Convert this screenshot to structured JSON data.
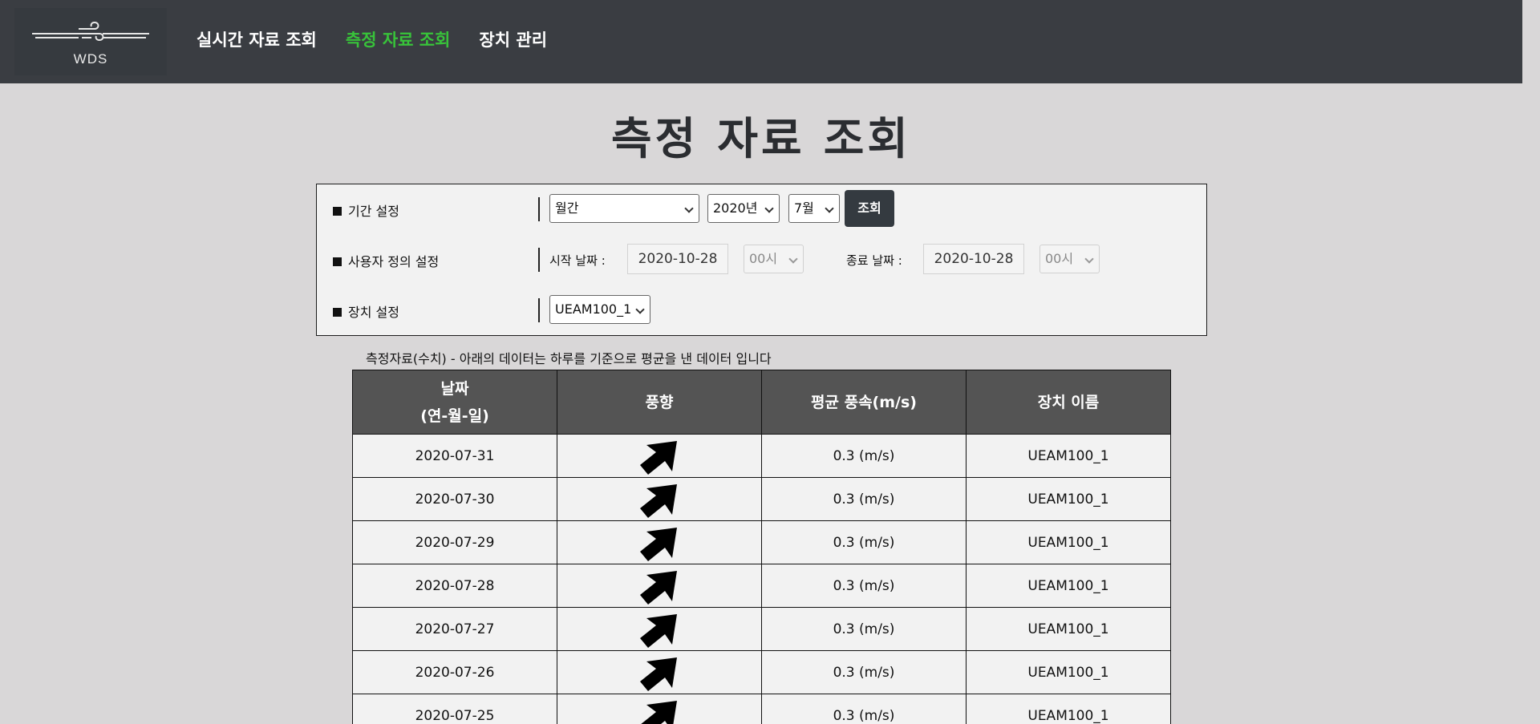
{
  "header": {
    "logo_text": "WDS",
    "nav": [
      {
        "label": "실시간 자료 조회",
        "active": false
      },
      {
        "label": "측정 자료 조회",
        "active": true
      },
      {
        "label": "장치 관리",
        "active": false
      }
    ]
  },
  "page_title": "측정 자료 조회",
  "settings": {
    "period_label": "기간 설정",
    "period_type": "월간",
    "year": "2020년",
    "month": "7월",
    "search_button": "조회",
    "custom_label": "사용자 정의 설정",
    "start_label": "시작 날짜 :",
    "start_date": "2020-10-28",
    "start_hour": "00시",
    "end_label": "종료 날짜 :",
    "end_date": "2020-10-28",
    "end_hour": "00시",
    "device_label": "장치 설정",
    "device": "UEAM100_1"
  },
  "table": {
    "caption": "측정자료(수치) - 아래의 데이터는 하루를 기준으로 평균을 낸 데이터 입니다",
    "headers": {
      "date_line1": "날짜",
      "date_line2": "(연-월-일)",
      "direction": "풍향",
      "speed": "평균 풍속(m/s)",
      "device": "장치 이름"
    },
    "rows": [
      {
        "date": "2020-07-31",
        "speed": "0.3 (m/s)",
        "device": "UEAM100_1"
      },
      {
        "date": "2020-07-30",
        "speed": "0.3 (m/s)",
        "device": "UEAM100_1"
      },
      {
        "date": "2020-07-29",
        "speed": "0.3 (m/s)",
        "device": "UEAM100_1"
      },
      {
        "date": "2020-07-28",
        "speed": "0.3 (m/s)",
        "device": "UEAM100_1"
      },
      {
        "date": "2020-07-27",
        "speed": "0.3 (m/s)",
        "device": "UEAM100_1"
      },
      {
        "date": "2020-07-26",
        "speed": "0.3 (m/s)",
        "device": "UEAM100_1"
      },
      {
        "date": "2020-07-25",
        "speed": "0.3 (m/s)",
        "device": "UEAM100_1"
      }
    ]
  }
}
